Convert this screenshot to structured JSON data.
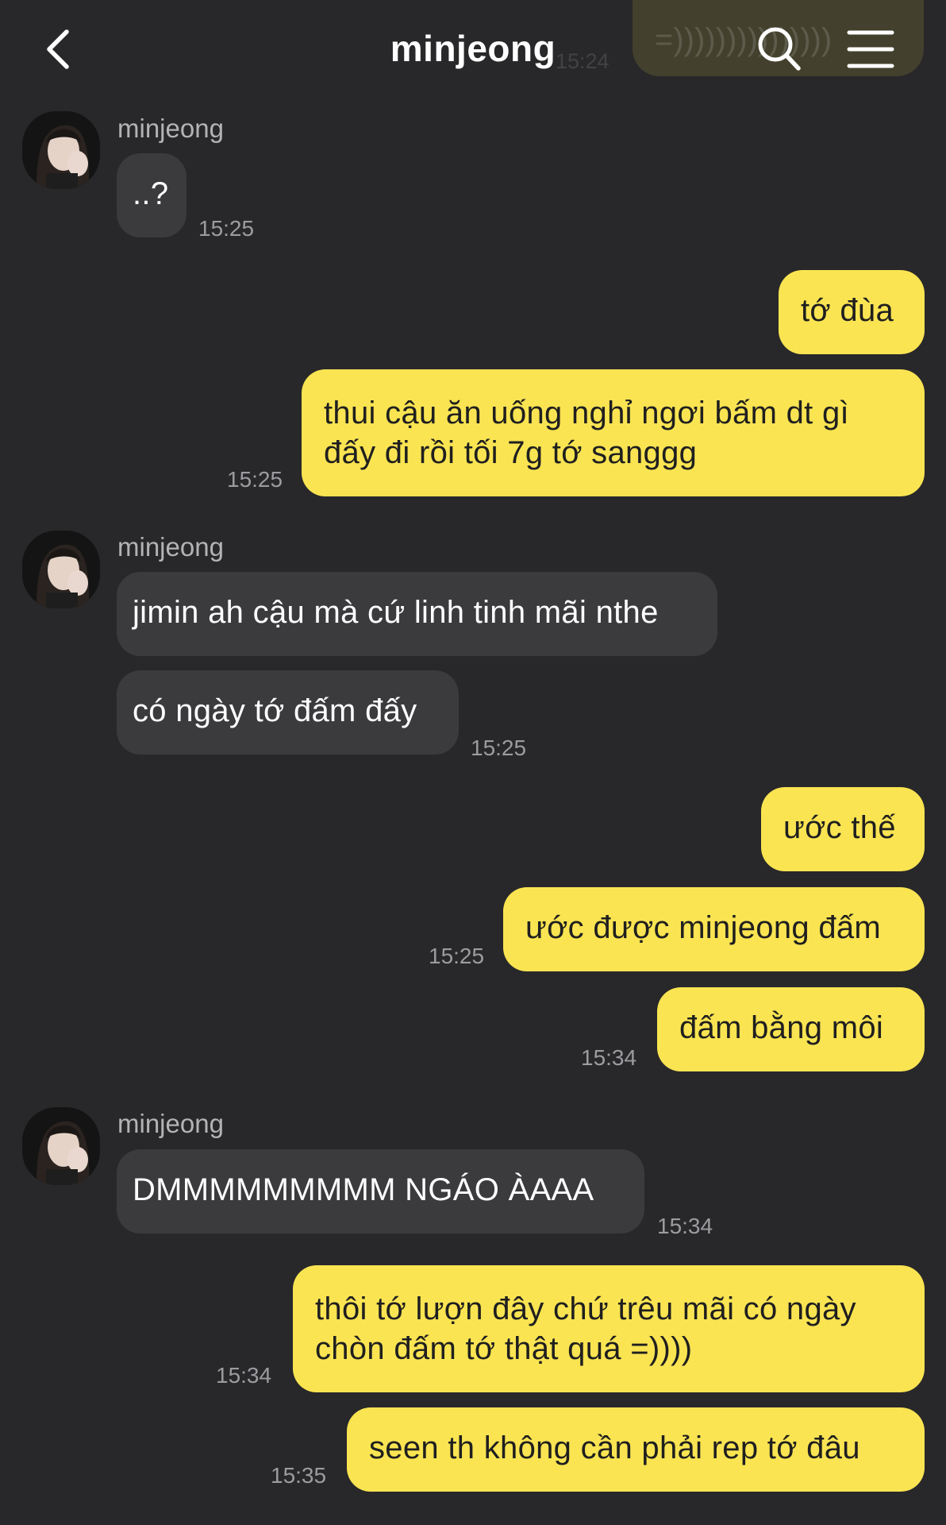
{
  "header": {
    "title": "minjeong",
    "back_icon": "chevron-left-icon",
    "search_icon": "search-icon",
    "menu_icon": "hamburger-menu-icon"
  },
  "ghost": {
    "text": "=)))))))))))))))",
    "time": "15:24"
  },
  "colors": {
    "background": "#28282a",
    "incoming_bubble": "#3b3b3e",
    "outgoing_bubble": "#fae452",
    "timestamp": "#9c9ca0"
  },
  "messages": [
    {
      "sender": "minjeong",
      "text": "..?",
      "time": "15:25"
    },
    {
      "text": "tớ đùa"
    },
    {
      "lines": [
        "thui cậu ăn uống nghỉ ngơi bấm dt gì",
        "đấy đi rồi tối 7g tớ sanggg"
      ],
      "time": "15:25"
    },
    {
      "sender": "minjeong",
      "text": "jimin ah cậu mà cứ linh tinh mãi nthe"
    },
    {
      "text": "có ngày tớ đấm đấy",
      "time": "15:25"
    },
    {
      "text": "ước thế"
    },
    {
      "text": "ước được minjeong đấm",
      "time": "15:25"
    },
    {
      "text": "đấm bằng môi",
      "time": "15:34"
    },
    {
      "sender": "minjeong",
      "text": "DMMMMMMMMM NGÁO ÀAAA",
      "time": "15:34"
    },
    {
      "lines": [
        "thôi tớ lượn đây chứ trêu mãi có ngày",
        "chòn đấm tớ thật quá =))))"
      ],
      "time": "15:34"
    },
    {
      "text": "seen th không cần phải rep tớ đâu",
      "time": "15:35"
    }
  ]
}
